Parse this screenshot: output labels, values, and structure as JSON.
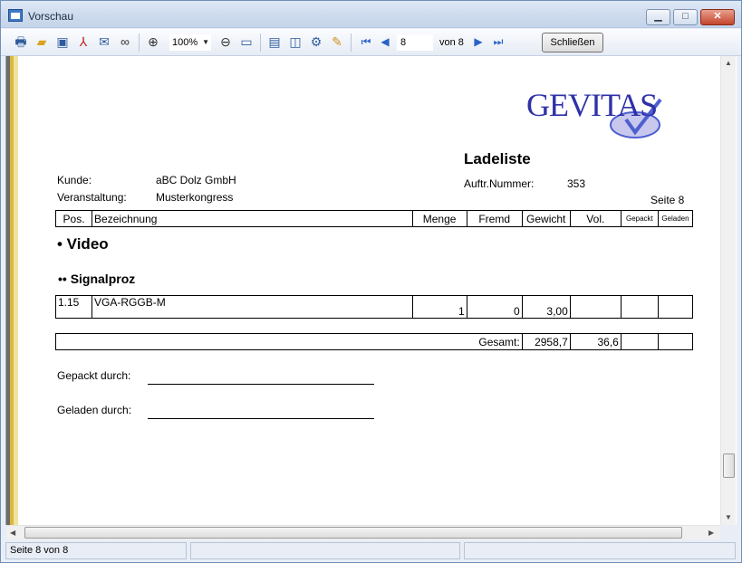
{
  "window": {
    "title": "Vorschau",
    "minimize": "▁",
    "maximize": "□",
    "close": "✕"
  },
  "toolbar": {
    "icons": [
      "print-icon",
      "open-folder-icon",
      "save-icon",
      "pdf-icon",
      "email-icon",
      "binoculars-icon",
      "zoom-in-icon",
      "zoom-out-icon",
      "fit-page-icon",
      "single-page-icon",
      "two-page-icon",
      "settings-icon",
      "edit-icon",
      "first-page-icon",
      "prev-page-icon",
      "next-page-icon",
      "last-page-icon"
    ],
    "zoom": "100%",
    "page_input": "8",
    "page_of": "von 8",
    "close_label": "Schließen"
  },
  "report": {
    "logo_text": "GEVITAS",
    "title": "Ladeliste",
    "kunde_label": "Kunde:",
    "kunde_value": "aBC Dolz GmbH",
    "veranstaltung_label": "Veranstaltung:",
    "veranstaltung_value": "Musterkongress",
    "auftr_label": "Auftr.Nummer:",
    "auftr_value": "353",
    "seite": "Seite 8",
    "columns": [
      "Pos.",
      "Bezeichnung",
      "Menge",
      "Fremd",
      "Gewicht",
      "Vol.",
      "Gepackt",
      "Geladen"
    ],
    "category1": "• Video",
    "category2": "•• Signalproz",
    "row": {
      "pos": "1.15",
      "bezeichnung": "VGA-RGGB-M",
      "menge": "1",
      "fremd": "0",
      "gewicht": "3,00",
      "vol": "",
      "gepackt": "",
      "geladen": ""
    },
    "gesamt_label": "Gesamt:",
    "gesamt_gewicht": "2958,7",
    "gesamt_vol": "36,6",
    "gepackt_durch": "Gepackt durch:",
    "geladen_durch": "Geladen durch:"
  },
  "status": {
    "page": "Seite 8 von 8"
  },
  "colors": {
    "logo_blue": "#2f31a8",
    "logo_check": "#4d5fd0",
    "nav_blue": "#2a63c8"
  }
}
